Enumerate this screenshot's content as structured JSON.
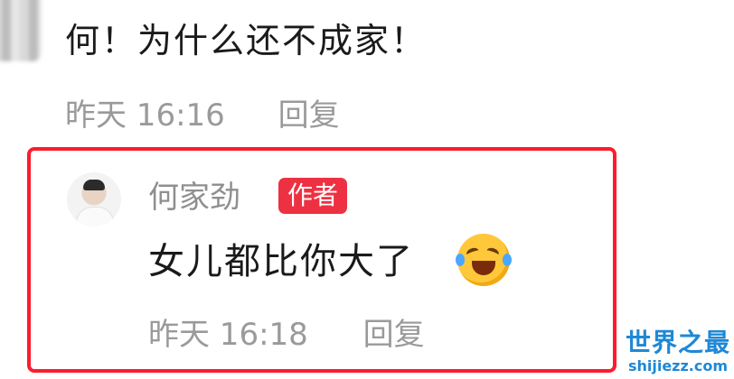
{
  "comment": {
    "text": "何！为什么还不成家！",
    "timestamp": "昨天 16:16",
    "reply_label": "回复"
  },
  "reply": {
    "author_name": "何家劲",
    "author_badge": "作者",
    "text": "女儿都比你大了",
    "emoji_icon": "rolling-on-floor-laughing-emoji",
    "timestamp": "昨天 16:18",
    "reply_label": "回复"
  },
  "watermark": {
    "title": "世界之最",
    "url": "shijiezz.com"
  },
  "colors": {
    "highlight_border": "#ff1b2d",
    "badge_bg": "#ee3142",
    "meta_text": "#9a9a9a",
    "watermark": "#1e88d6"
  }
}
